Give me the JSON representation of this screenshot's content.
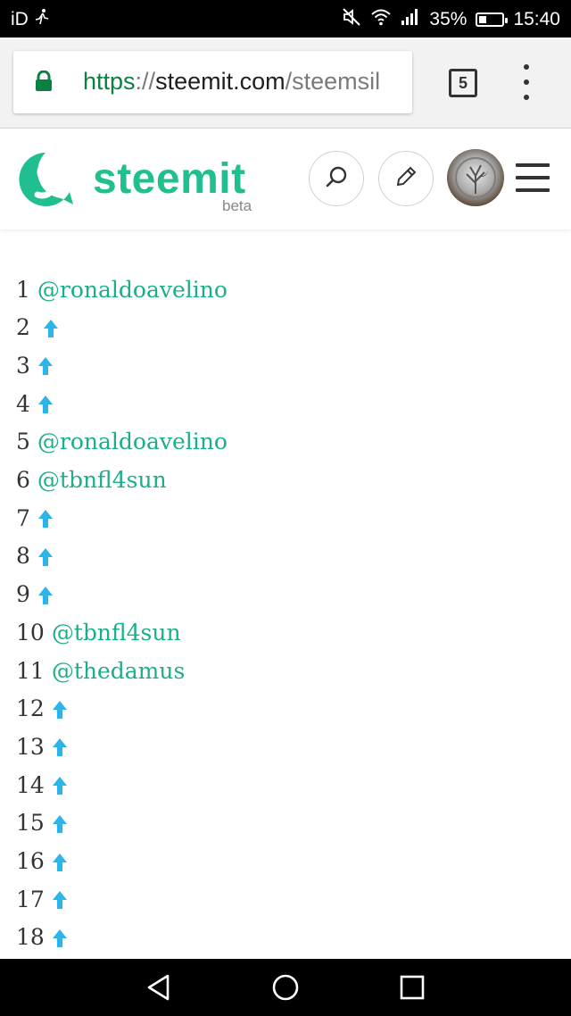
{
  "status_bar": {
    "carrier": "iD",
    "battery": "35%",
    "battery_level": 0.35,
    "time": "15:40"
  },
  "browser": {
    "url_scheme": "https",
    "url_sep": "://",
    "url_host": "steemit.com",
    "url_path": "/steemsil",
    "tab_count": "5"
  },
  "site": {
    "brand": "steemit",
    "brand_sub": "beta",
    "colors": {
      "accent": "#1fbf8f",
      "link": "#1aae8a",
      "upvote": "#2bb5e8"
    }
  },
  "list": [
    {
      "num": "1",
      "user": "@ronaldoavelino"
    },
    {
      "num": "2",
      "user": ""
    },
    {
      "num": "3",
      "user": ""
    },
    {
      "num": "4",
      "user": ""
    },
    {
      "num": "5",
      "user": "@ronaldoavelino"
    },
    {
      "num": "6",
      "user": "@tbnfl4sun"
    },
    {
      "num": "7",
      "user": ""
    },
    {
      "num": "8",
      "user": ""
    },
    {
      "num": "9",
      "user": ""
    },
    {
      "num": "10",
      "user": "@tbnfl4sun"
    },
    {
      "num": "11",
      "user": "@thedamus"
    },
    {
      "num": "12",
      "user": ""
    },
    {
      "num": "13",
      "user": ""
    },
    {
      "num": "14",
      "user": ""
    },
    {
      "num": "15",
      "user": ""
    },
    {
      "num": "16",
      "user": ""
    },
    {
      "num": "17",
      "user": ""
    },
    {
      "num": "18",
      "user": ""
    }
  ]
}
